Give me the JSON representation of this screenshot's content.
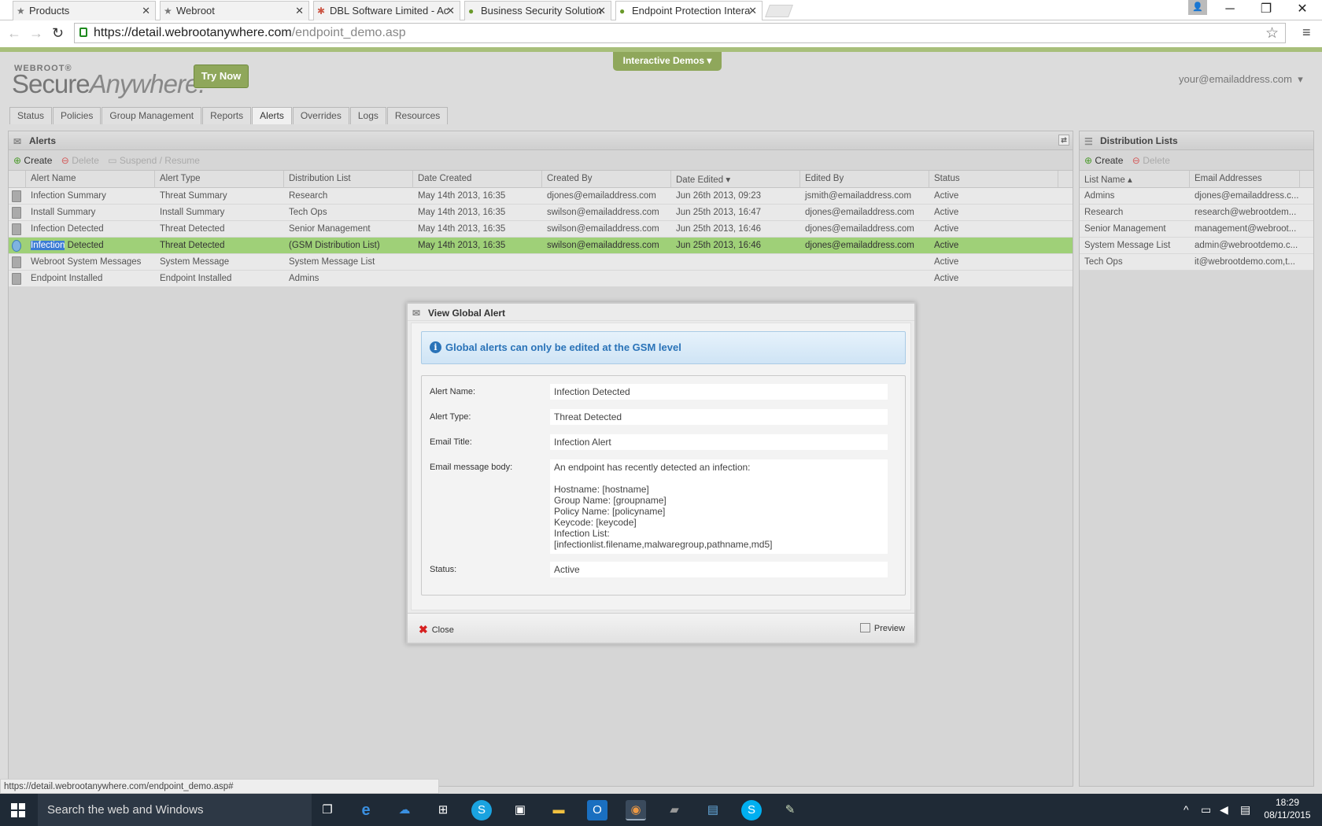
{
  "browser": {
    "tabs": [
      {
        "title": "Products",
        "favicon": "star-icon"
      },
      {
        "title": "Webroot",
        "favicon": "star-icon"
      },
      {
        "title": "DBL Software Limited - Ac",
        "favicon": "joomla-icon"
      },
      {
        "title": "Business Security Solution",
        "favicon": "webroot-icon"
      },
      {
        "title": "Endpoint Protection Intera",
        "favicon": "webroot-icon"
      }
    ],
    "url_host": "https://detail.webrootanywhere.com",
    "url_path": "/endpoint_demo.asp",
    "status_url": "https://detail.webrootanywhere.com/endpoint_demo.asp#"
  },
  "header": {
    "logo_small": "WEBROOT®",
    "logo_main_a": "Secure",
    "logo_main_b": "Anywhere.",
    "try_now": "Try Now",
    "demos": "Interactive Demos",
    "account": "your@emailaddress.com"
  },
  "nav": {
    "tabs": [
      "Status",
      "Policies",
      "Group Management",
      "Reports",
      "Alerts",
      "Overrides",
      "Logs",
      "Resources"
    ],
    "active": "Alerts"
  },
  "alerts": {
    "title": "Alerts",
    "create": "Create",
    "delete": "Delete",
    "suspend": "Suspend / Resume",
    "columns": [
      "Alert Name",
      "Alert Type",
      "Distribution List",
      "Date Created",
      "Created By",
      "Date Edited",
      "Edited By",
      "Status"
    ],
    "rows": [
      [
        "Infection Summary",
        "Threat Summary",
        "Research",
        "May 14th 2013, 16:35",
        "djones@emailaddress.com",
        "Jun 26th 2013, 09:23",
        "jsmith@emailaddress.com",
        "Active"
      ],
      [
        "Install Summary",
        "Install Summary",
        "Tech Ops",
        "May 14th 2013, 16:35",
        "swilson@emailaddress.com",
        "Jun 25th 2013, 16:47",
        "djones@emailaddress.com",
        "Active"
      ],
      [
        "Infection Detected",
        "Threat Detected",
        "Senior Management",
        "May 14th 2013, 16:35",
        "swilson@emailaddress.com",
        "Jun 25th 2013, 16:46",
        "djones@emailaddress.com",
        "Active"
      ],
      [
        "Infection Detected",
        "Threat Detected",
        "(GSM Distribution List)",
        "May 14th 2013, 16:35",
        "swilson@emailaddress.com",
        "Jun 25th 2013, 16:46",
        "djones@emailaddress.com",
        "Active"
      ],
      [
        "Webroot System Messages",
        "System Message",
        "System Message List",
        "",
        "",
        "",
        "",
        "Active"
      ],
      [
        "Endpoint Installed",
        "Endpoint Installed",
        "Admins",
        "",
        "",
        "",
        "",
        "Active"
      ]
    ],
    "selected_row": 3,
    "selected_highlight": "Infection",
    "selected_rest": " Detected"
  },
  "distribution": {
    "title": "Distribution Lists",
    "create": "Create",
    "delete": "Delete",
    "columns": [
      "List Name",
      "Email Addresses"
    ],
    "rows": [
      [
        "Admins",
        "djones@emailaddress.c..."
      ],
      [
        "Research",
        "research@webrootdem..."
      ],
      [
        "Senior Management",
        "management@webroot..."
      ],
      [
        "System Message List",
        "admin@webrootdemo.c..."
      ],
      [
        "Tech Ops",
        "it@webrootdemo.com,t..."
      ]
    ]
  },
  "modal": {
    "title": "View Global Alert",
    "info": "Global alerts can only be edited at the GSM level",
    "fields": [
      {
        "label": "Alert Name:",
        "value": "Infection Detected"
      },
      {
        "label": "Alert Type:",
        "value": "Threat Detected"
      },
      {
        "label": "Email Title:",
        "value": "Infection Alert"
      },
      {
        "label": "Email message body:",
        "value": "An endpoint has recently detected an infection:\n\nHostname: [hostname]\nGroup Name: [groupname]\nPolicy Name: [policyname]\nKeycode: [keycode]\nInfection List:\n[infectionlist.filename,malwaregroup,pathname,md5]"
      },
      {
        "label": "Status:",
        "value": "Active"
      }
    ],
    "close": "Close",
    "preview": "Preview"
  },
  "taskbar": {
    "search": "Search the web and Windows",
    "time": "18:29",
    "date": "08/11/2015"
  },
  "colors": {
    "accent_green": "#8fa75b",
    "selected_row": "#9fd078",
    "info_blue": "#2a73b8"
  }
}
